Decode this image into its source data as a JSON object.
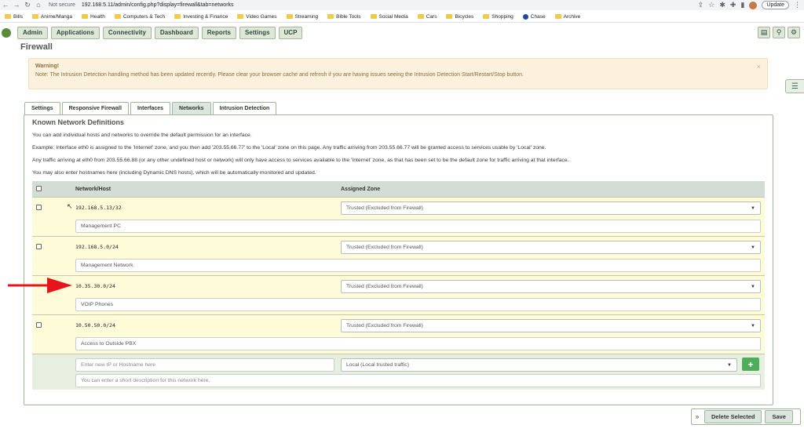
{
  "browser": {
    "security_label": "Not secure",
    "url": "192.168.5.11/admin/config.php?display=firewall&tab=networks",
    "update_label": "Update",
    "bookmarks": [
      "Bills",
      "Anime/Manga",
      "Health",
      "Computers & Tech",
      "Investing & Finance",
      "Video Games",
      "Streaming",
      "Bible Tools",
      "Social Media",
      "Cars",
      "Bicycles",
      "Shopping",
      "Chase",
      "Archive"
    ]
  },
  "nav": {
    "items": [
      "Admin",
      "Applications",
      "Connectivity",
      "Dashboard",
      "Reports",
      "Settings",
      "UCP"
    ]
  },
  "page": {
    "title": "Firewall",
    "warning_title": "Warning!",
    "warning_text": "Note: The Intrusion Detection handling method has been updated recently. Please clear your browser cache and refresh if you are having issues seeing the Intrusion Detection Start/Restart/Stop button.",
    "warning_close": "×"
  },
  "tabs": [
    "Settings",
    "Responsive Firewall",
    "Interfaces",
    "Networks",
    "Intrusion Detection"
  ],
  "panel": {
    "title": "Known Network Definitions",
    "desc1": "You can add individual hosts and networks to override the default permission for an interface.",
    "desc2": "Example: Interface eth0 is assigned to the 'Internet' zone, and you then add '203.55.66.77' to the 'Local' zone on this page. Any traffic arriving from 203.55.66.77 will be granted access to services usable by 'Local' zone.",
    "desc3": "Any traffic arriving at eth0 from 203.55.66.88 (or any other undefined host or network) will only have access to services available to the 'Internet' zone, as that has been set to be the default zone for traffic arriving at that interface.",
    "desc4": "You may also enter hostnames here (including Dynamic DNS hosts), which will be automatically monitored and updated."
  },
  "table": {
    "col_network": "Network/Host",
    "col_zone": "Assigned Zone",
    "rows": [
      {
        "ip": "192.168.5.13/32",
        "zone": "Trusted (Excluded from Firewall)",
        "desc": "Management PC"
      },
      {
        "ip": "192.168.5.0/24",
        "zone": "Trusted (Excluded from Firewall)",
        "desc": "Management Network"
      },
      {
        "ip": "10.35.30.0/24",
        "zone": "Trusted (Excluded from Firewall)",
        "desc": "VOIP Phones"
      },
      {
        "ip": "10.50.50.0/24",
        "zone": "Trusted (Excluded from Firewall)",
        "desc": "Access to Outside PBX"
      }
    ],
    "new_ip_placeholder": "Enter new IP or Hostname here",
    "new_zone": "Local (Local trusted traffic)",
    "new_desc_placeholder": "You can enter a short description for this network here.",
    "add_label": "+"
  },
  "footer": {
    "delete_label": "Delete Selected",
    "save_label": "Save"
  }
}
